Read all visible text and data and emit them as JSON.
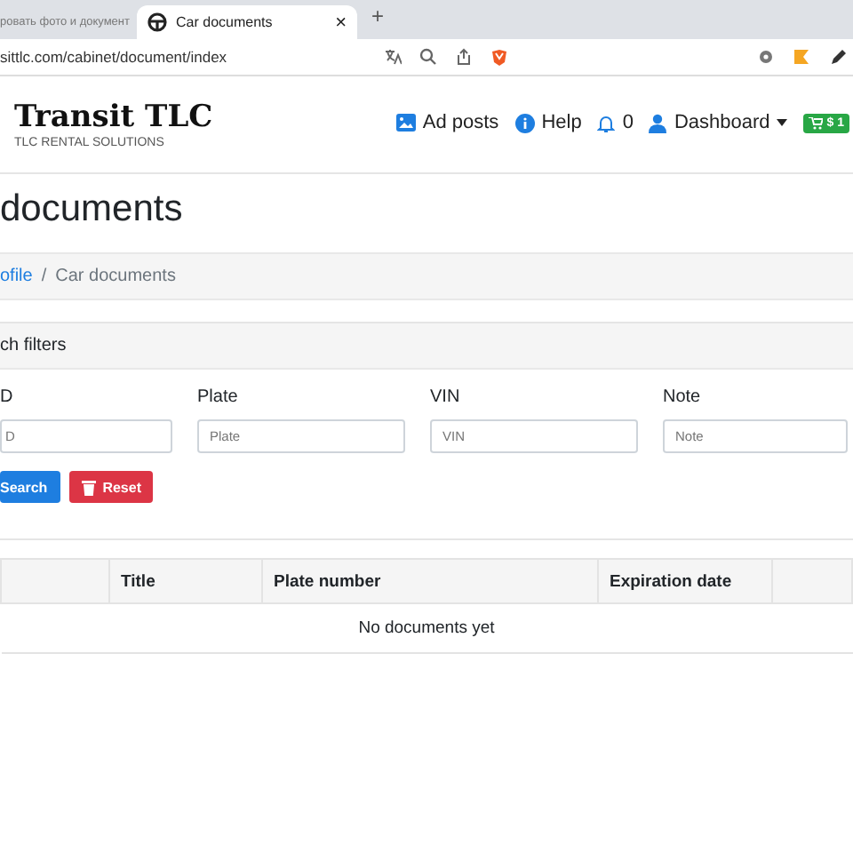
{
  "browser": {
    "tabs": [
      {
        "label": "ровать фото и документ",
        "selected": false
      },
      {
        "label": "Car documents",
        "selected": true
      }
    ],
    "new_tab": "+",
    "close": "×",
    "url": "sittlc.com/cabinet/document/index"
  },
  "navbar": {
    "brand": "Transit TLC",
    "tagline": "TLC RENTAL SOLUTIONS",
    "links": [
      {
        "kind": "picture",
        "label": "Ad posts"
      },
      {
        "kind": "info",
        "label": "Help"
      },
      {
        "kind": "bell",
        "label": "0"
      },
      {
        "kind": "user",
        "label": "Dashboard",
        "dropdown": true
      }
    ],
    "cart_badge": "$ 1"
  },
  "page_title": "documents",
  "breadcrumb": [
    {
      "label": "ofile",
      "link": true
    },
    {
      "label": "Car documents",
      "link": false
    }
  ],
  "breadcrumb_separator": "/",
  "filters": {
    "title": "ch filters",
    "fields": [
      {
        "label": "D",
        "placeholder": "D"
      },
      {
        "label": "Plate",
        "placeholder": "Plate"
      },
      {
        "label": "VIN",
        "placeholder": "VIN"
      },
      {
        "label": "Note",
        "placeholder": "Note"
      }
    ],
    "buttons": [
      {
        "kind": "search",
        "label": "Search"
      },
      {
        "kind": "reset",
        "label": "Reset"
      }
    ]
  },
  "table": {
    "columns": [
      "",
      "Title",
      "Plate number",
      "Expiration date",
      ""
    ],
    "empty_text": "No documents yet"
  }
}
